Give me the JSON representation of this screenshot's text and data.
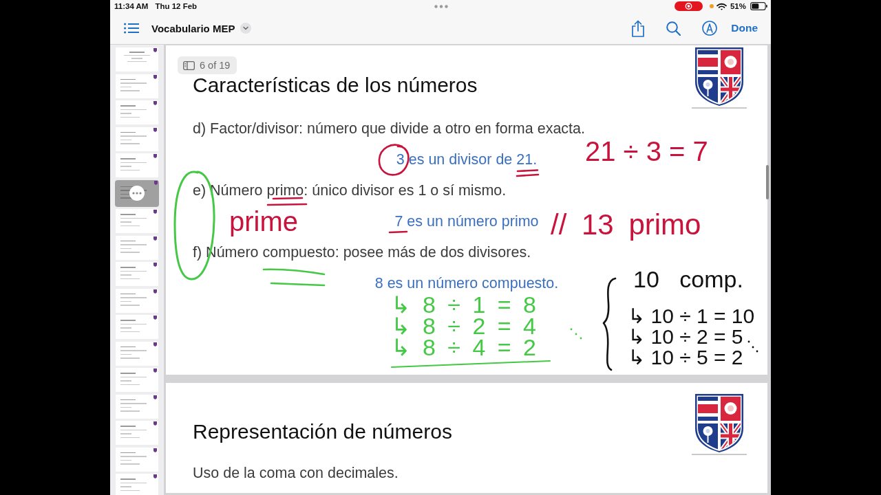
{
  "status_bar": {
    "time": "11:34 AM",
    "date": "Thu 12 Feb",
    "battery": "51%"
  },
  "toolbar": {
    "title": "Vocabulario MEP",
    "done": "Done"
  },
  "sidebar": {
    "thumbnails": [
      {
        "selected": false
      },
      {
        "selected": false
      },
      {
        "selected": false
      },
      {
        "selected": false
      },
      {
        "selected": false
      },
      {
        "selected": true
      },
      {
        "selected": false
      },
      {
        "selected": false
      },
      {
        "selected": false
      },
      {
        "selected": false
      },
      {
        "selected": false
      },
      {
        "selected": false
      },
      {
        "selected": false
      },
      {
        "selected": false
      },
      {
        "selected": false
      },
      {
        "selected": false
      },
      {
        "selected": false
      }
    ]
  },
  "page_indicator": "6 of 19",
  "pages": [
    {
      "title": "Características de los números",
      "lines": [
        {
          "kind": "definition",
          "text": "d) Factor/divisor: número que divide a otro en forma exacta."
        },
        {
          "kind": "example",
          "text": "3 es un divisor de 21."
        },
        {
          "kind": "definition",
          "text": "e) Número primo: único divisor es 1 o sí mismo."
        },
        {
          "kind": "example",
          "text": "7 es un número primo"
        },
        {
          "kind": "definition",
          "text": "f) Número compuesto: posee más de dos divisores."
        },
        {
          "kind": "example",
          "text": "8 es un número compuesto."
        }
      ],
      "annotations": [
        {
          "text": "21 ÷ 3 = 7",
          "color": "#c8133c"
        },
        {
          "text": "prime",
          "color": "#c8133c"
        },
        {
          "text": "// 13 primo",
          "color": "#c8133c"
        },
        {
          "text": "10 comp.",
          "color": "#111111"
        },
        {
          "text": "↳ 8 ÷ 1 = 8",
          "color": "#45c845"
        },
        {
          "text": "↳ 10 ÷ 1 = 10",
          "color": "#111111"
        },
        {
          "text": "↳ 8 ÷ 2 = 4",
          "color": "#45c845"
        },
        {
          "text": "↳ 10 ÷ 2 = 5",
          "color": "#111111"
        },
        {
          "text": "↳ 8 ÷ 4 = 2",
          "color": "#45c845"
        },
        {
          "text": "↳ 10 ÷ 5 = 2",
          "color": "#111111"
        }
      ]
    },
    {
      "title": "Representación de números",
      "lines": [
        {
          "kind": "definition",
          "text": "Uso de la coma con decimales."
        }
      ]
    }
  ]
}
